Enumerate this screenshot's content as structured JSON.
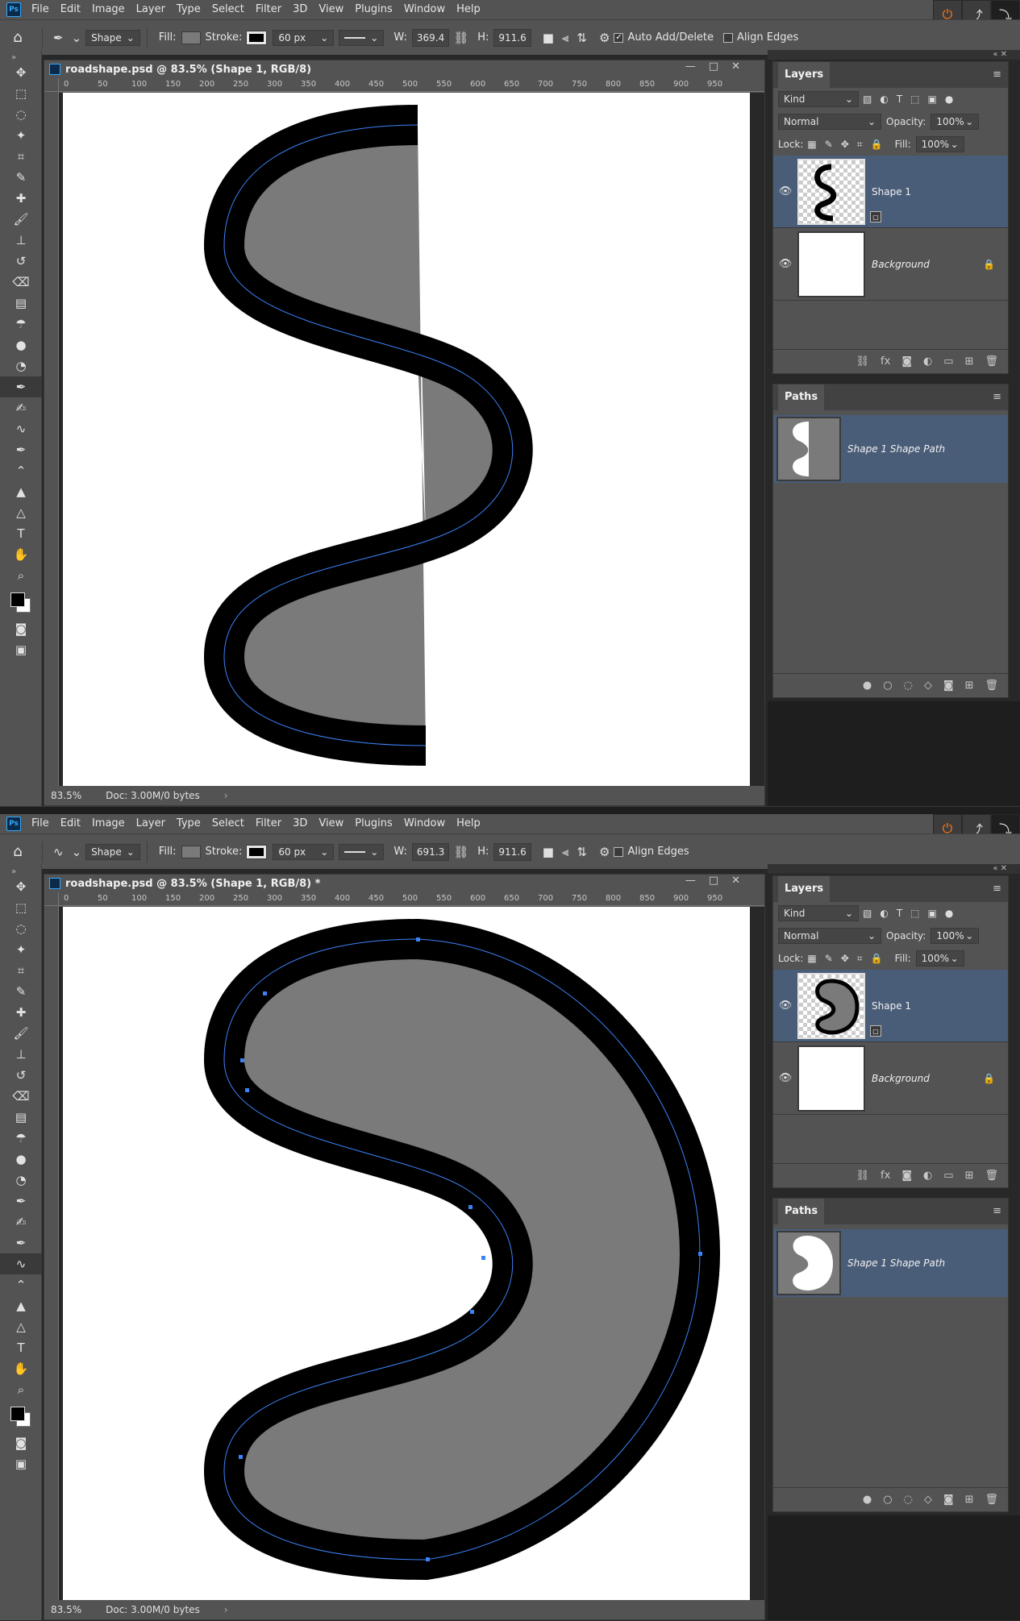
{
  "menu": {
    "logo": "Ps",
    "items": [
      "File",
      "Edit",
      "Image",
      "Layer",
      "Type",
      "Select",
      "Filter",
      "3D",
      "View",
      "Plugins",
      "Window",
      "Help"
    ]
  },
  "top": {
    "options": {
      "mode": "Shape",
      "fill_label": "Fill:",
      "stroke_label": "Stroke:",
      "stroke_width": "60 px",
      "w_label": "W:",
      "w_value": "369.4",
      "h_label": "H:",
      "h_value": "911.6",
      "auto_add_delete": "Auto Add/Delete",
      "align_edges": "Align Edges"
    },
    "document": {
      "title": "roadshape.psd @ 83.5% (Shape 1, RGB/8)",
      "zoom": "83.5%",
      "doc_size": "Doc: 3.00M/0 bytes"
    }
  },
  "bottom": {
    "options": {
      "mode": "Shape",
      "fill_label": "Fill:",
      "stroke_label": "Stroke:",
      "stroke_width": "60 px",
      "w_label": "W:",
      "w_value": "691.3",
      "h_label": "H:",
      "h_value": "911.6",
      "align_edges": "Align Edges"
    },
    "document": {
      "title": "roadshape.psd @ 83.5% (Shape 1, RGB/8) *",
      "zoom": "83.5%",
      "doc_size": "Doc: 3.00M/0 bytes"
    }
  },
  "ruler_ticks": [
    "0",
    "50",
    "100",
    "150",
    "200",
    "250",
    "300",
    "350",
    "400",
    "450",
    "500",
    "550",
    "600",
    "650",
    "700",
    "750",
    "800",
    "850",
    "900",
    "950"
  ],
  "layers_panel": {
    "title": "Layers",
    "kind": "Kind",
    "blend": "Normal",
    "opacity_label": "Opacity:",
    "opacity": "100%",
    "lock_label": "Lock:",
    "fill_label": "Fill:",
    "fill": "100%",
    "layer1": "Shape 1",
    "layer2": "Background"
  },
  "paths_panel": {
    "title": "Paths",
    "path": "Shape 1 Shape Path"
  },
  "colors": {
    "accent_selected": "#4a5d78",
    "shape_fill": "#7a7a7a",
    "path_line": "#3b82f6"
  }
}
